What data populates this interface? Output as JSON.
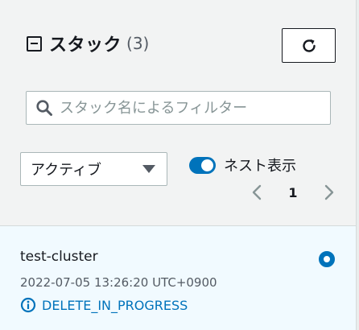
{
  "header": {
    "title": "スタック",
    "count": "(3)"
  },
  "search": {
    "placeholder": "スタック名によるフィルター",
    "value": ""
  },
  "filter": {
    "selected": "アクティブ"
  },
  "nested_toggle": {
    "label": "ネスト表示",
    "on": true
  },
  "pagination": {
    "current_page": "1"
  },
  "stacks": [
    {
      "name": "test-cluster",
      "timestamp": "2022-07-05 13:26:20 UTC+0900",
      "status": "DELETE_IN_PROGRESS",
      "selected": true
    }
  ],
  "colors": {
    "accent": "#0073bb",
    "selected_bg": "#f1faff",
    "panel_bg": "#f2f3f3"
  },
  "icons": {
    "collapse": "collapse-square-icon",
    "refresh": "refresh-icon",
    "search": "search-icon",
    "caret": "caret-down-icon",
    "prev": "chevron-left-icon",
    "next": "chevron-right-icon",
    "status": "info-icon"
  }
}
